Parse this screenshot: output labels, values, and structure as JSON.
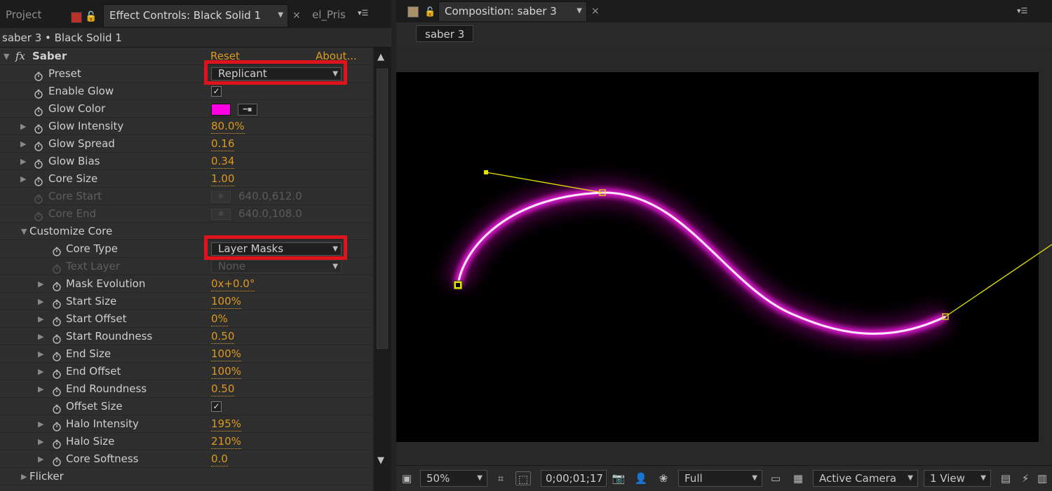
{
  "left_panel": {
    "tabs": {
      "project": "Project",
      "effect_controls": "Effect Controls: Black Solid 1",
      "next": "el_Pris"
    },
    "subheader": "saber 3 • Black Solid 1",
    "effect": {
      "fx_glyph": "fx",
      "name": "Saber",
      "reset": "Reset",
      "about": "About..."
    },
    "rows": [
      {
        "label": "Preset",
        "control": "dropdown",
        "value": "Replicant"
      },
      {
        "label": "Enable Glow",
        "control": "checkbox",
        "checked": "✓"
      },
      {
        "label": "Glow Color",
        "control": "color",
        "color": "#ff00e4"
      },
      {
        "label": "Glow Intensity",
        "value": "80.0%"
      },
      {
        "label": "Glow Spread",
        "value": "0.16"
      },
      {
        "label": "Glow Bias",
        "value": "0.34"
      },
      {
        "label": "Core Size",
        "value": "1.00"
      },
      {
        "label": "Core Start",
        "control": "point",
        "value": "640.0,612.0",
        "disabled": true
      },
      {
        "label": "Core End",
        "control": "point",
        "value": "640.0,108.0",
        "disabled": true
      },
      {
        "label": "Customize Core",
        "control": "group"
      },
      {
        "label": "Core Type",
        "control": "dropdown",
        "value": "Layer Masks"
      },
      {
        "label": "Text Layer",
        "control": "dropdown",
        "value": "None",
        "disabled": true
      },
      {
        "label": "Mask Evolution",
        "value": "0x+0.0°"
      },
      {
        "label": "Start Size",
        "value": "100%"
      },
      {
        "label": "Start Offset",
        "value": "0%"
      },
      {
        "label": "Start Roundness",
        "value": "0.50"
      },
      {
        "label": "End Size",
        "value": "100%"
      },
      {
        "label": "End Offset",
        "value": "100%"
      },
      {
        "label": "End Roundness",
        "value": "0.50"
      },
      {
        "label": "Offset Size",
        "control": "checkbox",
        "checked": "✓"
      },
      {
        "label": "Halo Intensity",
        "value": "195%"
      },
      {
        "label": "Halo Size",
        "value": "210%"
      },
      {
        "label": "Core Softness",
        "value": "0.0"
      },
      {
        "label": "Flicker",
        "control": "group"
      }
    ]
  },
  "composition": {
    "tab_title": "Composition: saber 3",
    "breadcrumb": "saber 3",
    "toolbar": {
      "zoom": "50%",
      "timecode": "0;00;01;17",
      "resolution": "Full",
      "camera": "Active Camera",
      "views": "1 View"
    }
  },
  "colors": {
    "accent_value": "#dc9a1e",
    "highlight_box": "#e0121c",
    "saber_glow": "#ff00e4",
    "mask_path": "#e6e600"
  }
}
